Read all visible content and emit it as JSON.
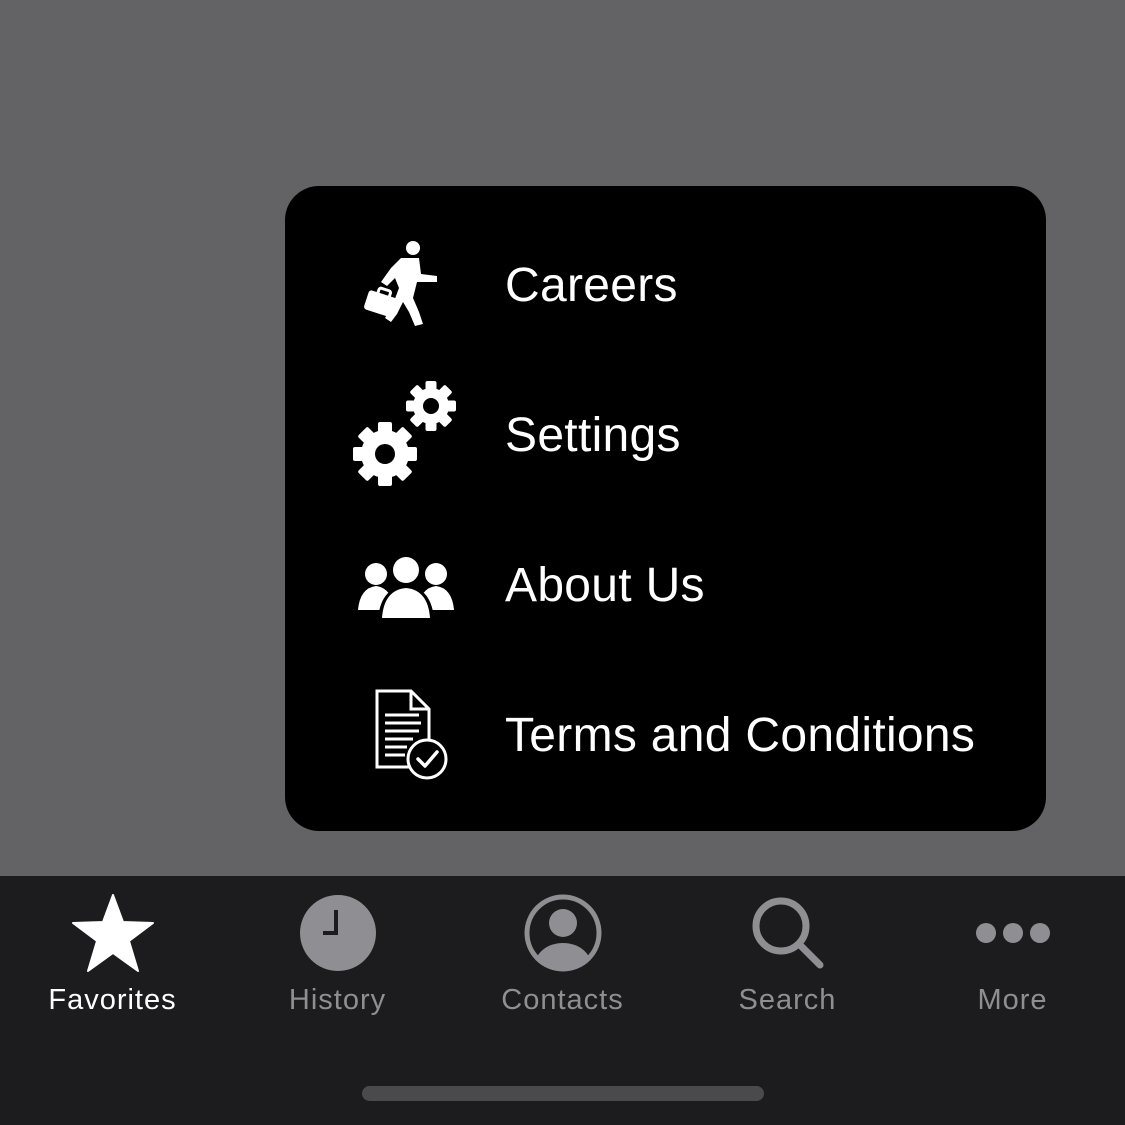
{
  "menu": {
    "items": [
      {
        "label": "Careers",
        "icon": "briefcase-runner-icon"
      },
      {
        "label": "Settings",
        "icon": "gears-icon"
      },
      {
        "label": "About Us",
        "icon": "group-icon"
      },
      {
        "label": "Terms and Conditions",
        "icon": "document-check-icon"
      }
    ]
  },
  "tabbar": {
    "active": "Favorites",
    "tabs": [
      {
        "label": "Favorites",
        "icon": "star-icon"
      },
      {
        "label": "History",
        "icon": "clock-icon"
      },
      {
        "label": "Contacts",
        "icon": "person-circle-icon"
      },
      {
        "label": "Search",
        "icon": "magnifier-icon"
      },
      {
        "label": "More",
        "icon": "ellipsis-icon"
      }
    ]
  },
  "colors": {
    "backdrop": "#636366",
    "menu_bg": "#000000",
    "tabbar_bg": "#1c1c1e",
    "active": "#ffffff",
    "inactive": "#8e8e93"
  }
}
